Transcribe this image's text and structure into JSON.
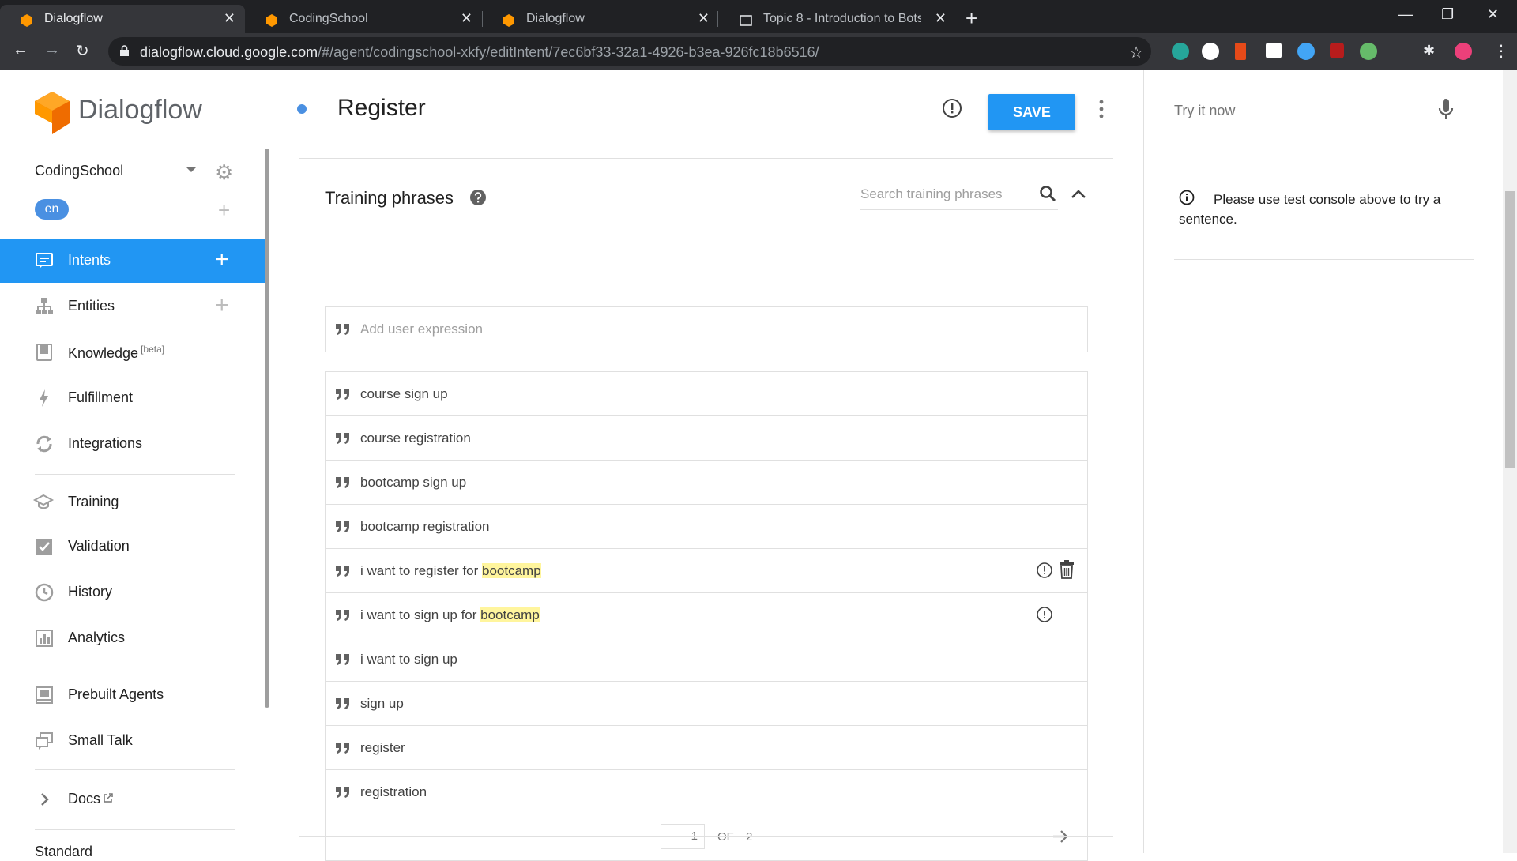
{
  "browser": {
    "tabs": [
      {
        "title": "Dialogflow",
        "active": true
      },
      {
        "title": "CodingSchool",
        "active": false
      },
      {
        "title": "Dialogflow",
        "active": false
      },
      {
        "title": "Topic 8 - Introduction to Bots – S",
        "active": false
      }
    ],
    "url_host": "dialogflow.cloud.google.com",
    "url_path": "/#/agent/codingschool-xkfy/editIntent/7ec6bf33-32a1-4926-b3ea-926fc18b6516/"
  },
  "sidebar": {
    "brand": "Dialogflow",
    "agent_name": "CodingSchool",
    "language": "en",
    "items": [
      {
        "label": "Intents",
        "icon": "chat-icon",
        "active": true
      },
      {
        "label": "Entities",
        "icon": "hierarchy-icon"
      },
      {
        "label": "Knowledge",
        "sup": "[beta]",
        "icon": "book-icon"
      },
      {
        "label": "Fulfillment",
        "icon": "bolt-icon"
      },
      {
        "label": "Integrations",
        "icon": "sync-icon"
      },
      {
        "label": "Training",
        "icon": "graduation-cap-icon"
      },
      {
        "label": "Validation",
        "icon": "check-box-icon"
      },
      {
        "label": "History",
        "icon": "clock-icon"
      },
      {
        "label": "Analytics",
        "icon": "bar-chart-icon"
      },
      {
        "label": "Prebuilt Agents",
        "icon": "template-icon"
      },
      {
        "label": "Small Talk",
        "icon": "chat-bubbles-icon"
      },
      {
        "label": "Docs",
        "icon": "chevron-right-icon"
      }
    ],
    "footer_text": "Standard"
  },
  "header": {
    "intent_name": "Register",
    "save_label": "SAVE"
  },
  "training": {
    "title": "Training phrases",
    "search_placeholder": "Search training phrases",
    "add_placeholder": "Add user expression",
    "phrases": [
      {
        "text": "course sign up"
      },
      {
        "text": "course registration"
      },
      {
        "text": "bootcamp sign up"
      },
      {
        "text": "bootcamp registration"
      },
      {
        "text": "i want to register for ",
        "entity": "bootcamp",
        "warning": true,
        "trash": true
      },
      {
        "text": "i want to sign up for ",
        "entity": "bootcamp",
        "warning": true
      },
      {
        "text": "i want to sign up"
      },
      {
        "text": "sign up"
      },
      {
        "text": "register"
      },
      {
        "text": "registration"
      }
    ],
    "pagination": {
      "current": "1",
      "of_label": "OF",
      "total": "2"
    }
  },
  "right_panel": {
    "try_placeholder": "Try it now",
    "info_text": "Please use test console above to try a sentence."
  },
  "colors": {
    "primary": "#2196f3",
    "dot": "#4a90e2",
    "highlight": "#fff59d",
    "logo_orange": "#ef6c00"
  }
}
